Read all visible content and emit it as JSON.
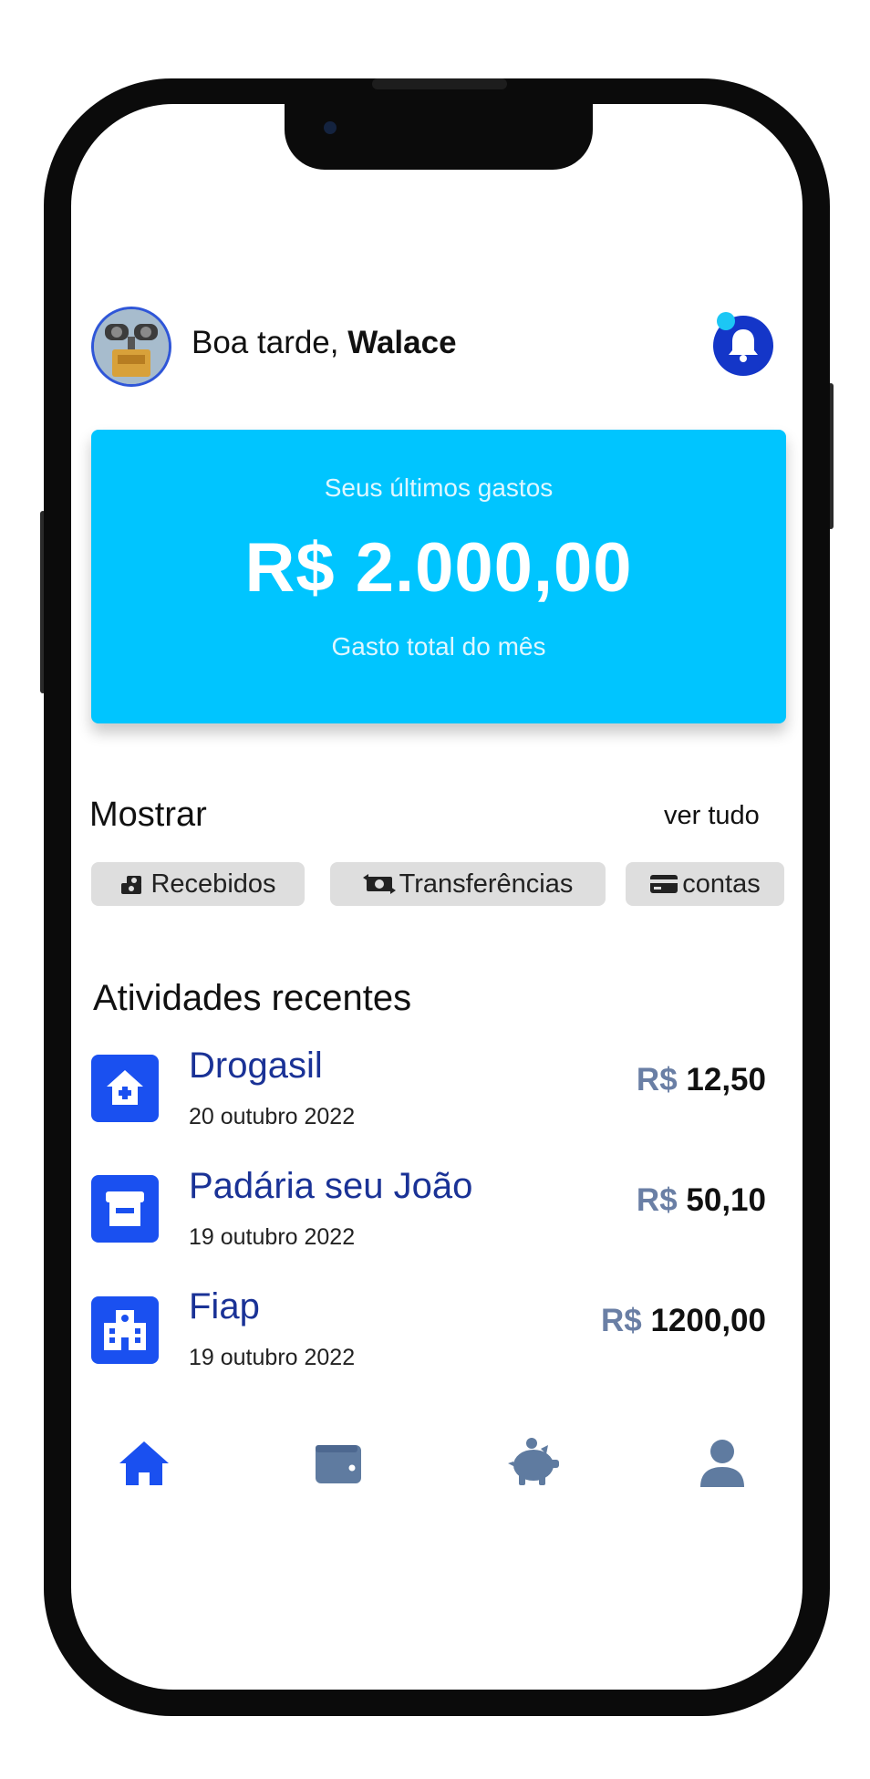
{
  "header": {
    "greeting_prefix": "Boa tarde, ",
    "user_name": "Walace",
    "notification_icon": "bell-icon",
    "avatar_icon": "avatar"
  },
  "summary_card": {
    "subtitle": "Seus últimos gastos",
    "amount": "R$ 2.000,00",
    "caption": "Gasto total do mês"
  },
  "show_section": {
    "title": "Mostrar",
    "see_all": "ver tudo",
    "filters": [
      {
        "label": "Recebidos",
        "icon": "money-hand-icon"
      },
      {
        "label": "Transferências",
        "icon": "money-transfer-icon"
      },
      {
        "label": "contas",
        "icon": "credit-card-icon"
      }
    ]
  },
  "recent": {
    "title": "Atividades recentes",
    "items": [
      {
        "name": "Drogasil",
        "date": "20 outubro 2022",
        "currency": "R$",
        "value": "12,50",
        "icon": "pharmacy-icon"
      },
      {
        "name": "Padária seu João",
        "date": "19 outubro 2022",
        "currency": "R$",
        "value": "50,10",
        "icon": "store-icon"
      },
      {
        "name": "Fiap",
        "date": "19 outubro 2022",
        "currency": "R$",
        "value": "1200,00",
        "icon": "school-icon"
      }
    ]
  },
  "bottom_nav": [
    {
      "name": "home",
      "icon": "home-icon",
      "active": true
    },
    {
      "name": "wallet",
      "icon": "wallet-icon",
      "active": false
    },
    {
      "name": "savings",
      "icon": "piggy-bank-icon",
      "active": false
    },
    {
      "name": "profile",
      "icon": "user-icon",
      "active": false
    }
  ],
  "colors": {
    "accent": "#1a50f0",
    "card_background": "#00c5ff",
    "nav_inactive": "#5f7ba0",
    "title_blue": "#1a3296"
  }
}
